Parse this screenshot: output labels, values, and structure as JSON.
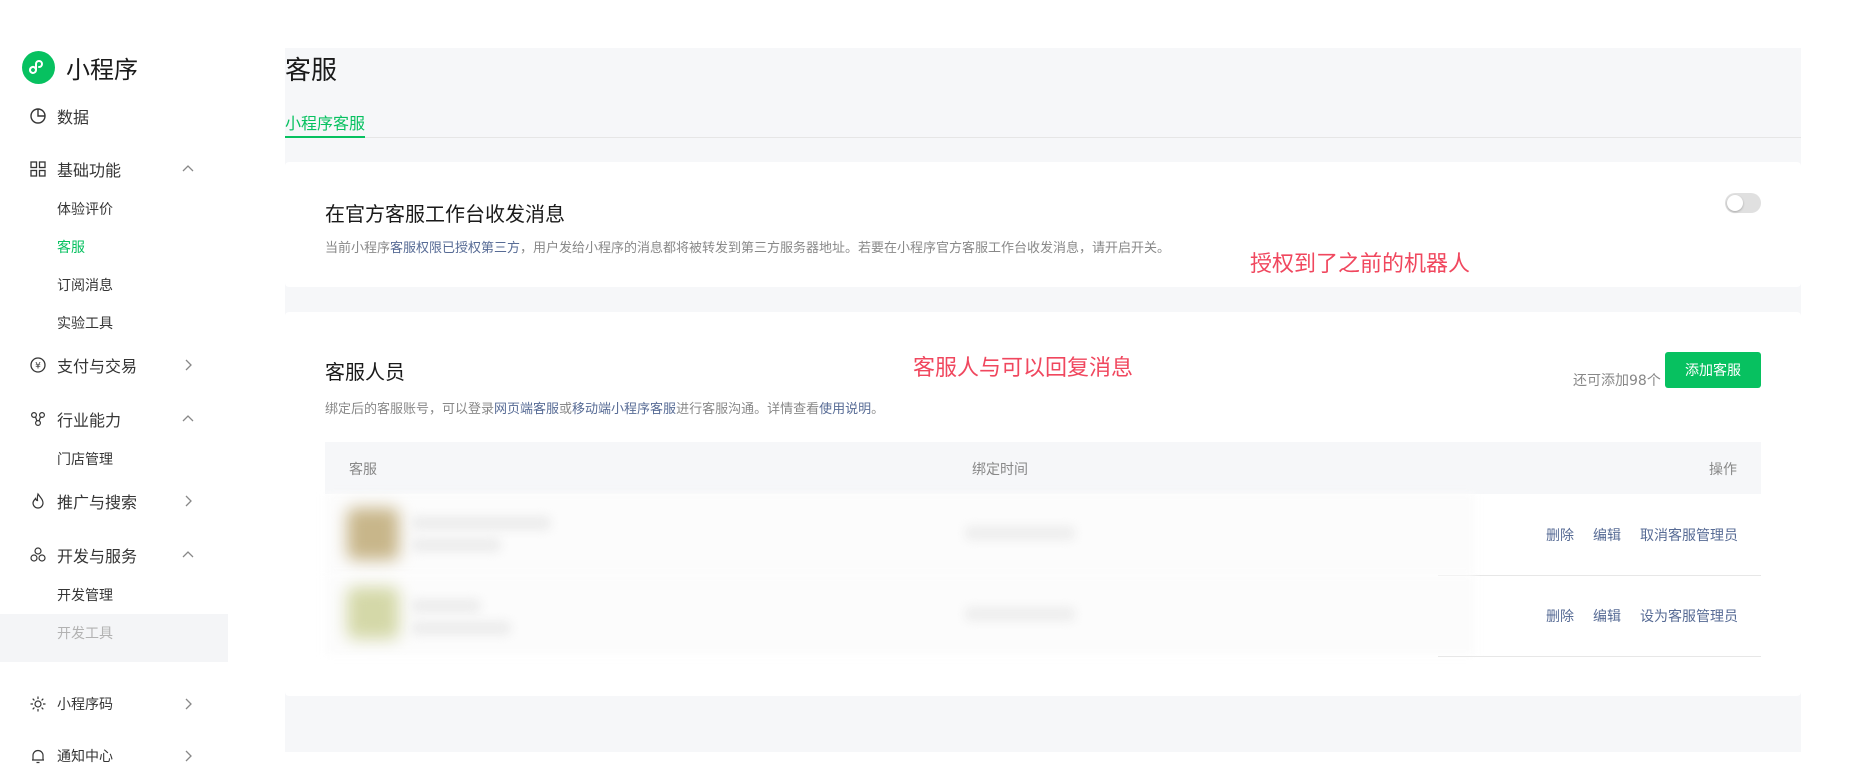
{
  "brand": {
    "name": "小程序",
    "accent": "#07c160"
  },
  "sidebar": {
    "items": [
      {
        "label": "数据",
        "icon": "chart-pie-icon"
      },
      {
        "label": "基础功能",
        "icon": "grid-icon",
        "sub": [
          "体验评价",
          "客服",
          "订阅消息",
          "实验工具"
        ]
      },
      {
        "label": "支付与交易",
        "icon": "yuan-circle-icon"
      },
      {
        "label": "行业能力",
        "icon": "nodes-icon",
        "sub": [
          "门店管理"
        ]
      },
      {
        "label": "推广与搜索",
        "icon": "flame-icon"
      },
      {
        "label": "开发与服务",
        "icon": "cluster-icon",
        "sub": [
          "开发管理",
          "开发工具"
        ]
      },
      {
        "label": "小程序码",
        "icon": "sun-icon"
      },
      {
        "label": "通知中心",
        "icon": "bell-icon"
      }
    ]
  },
  "page": {
    "title": "客服",
    "tab": "小程序客服"
  },
  "workbench": {
    "title": "在官方客服工作台收发消息",
    "desc_prefix": "当前小程序",
    "desc_link": "客服权限已授权第三方",
    "desc_suffix": "，用户发给小程序的消息都将被转发到第三方服务器地址。若要在小程序官方客服工作台收发消息，请开启开关。",
    "toggle_on": false,
    "annotation": "授权到了之前的机器人"
  },
  "staff": {
    "title": "客服人员",
    "annotation": "客服人与可以回复消息",
    "remaining": "还可添加98个",
    "add_button": "添加客服",
    "desc_a": "绑定后的客服账号，可以登录",
    "link_web": "网页端客服",
    "desc_b": "或",
    "link_mobile": "移动端小程序客服",
    "desc_c": "进行客服沟通。详情查看",
    "link_help": "使用说明",
    "desc_d": "。",
    "columns": [
      "客服",
      "绑定时间",
      "操作"
    ],
    "rows": [
      {
        "actions": [
          "删除",
          "编辑",
          "取消客服管理员"
        ]
      },
      {
        "actions": [
          "删除",
          "编辑",
          "设为客服管理员"
        ]
      }
    ]
  }
}
